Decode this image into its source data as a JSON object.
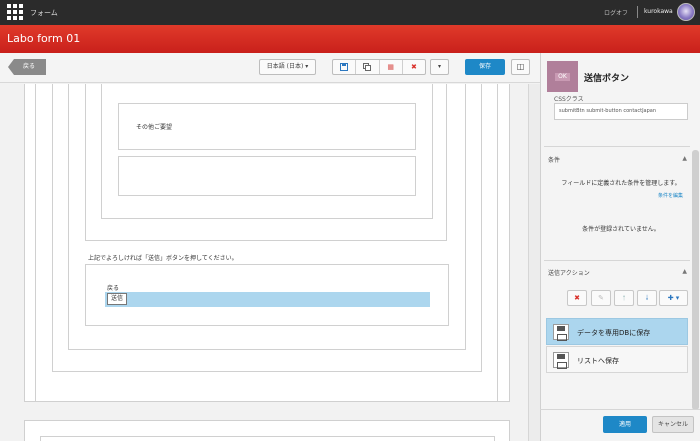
{
  "topbar": {
    "app_name": "フォーム",
    "logout": "ログオフ",
    "username": "kurokawa"
  },
  "header": {
    "form_title": "Labo form 01"
  },
  "toolbar": {
    "back_label": "戻る",
    "language": "日本語 (日本)",
    "save_label": "保存"
  },
  "canvas": {
    "other_label": "その他ご要望",
    "notice_text": "上記でよろしければ「送信」ボタンを押してください。",
    "back_text": "戻る",
    "submit_text": "送信"
  },
  "panel": {
    "thumb_text": "OK",
    "title": "送信ボタン",
    "css_label": "CSSクラス",
    "css_value": "submitBtn submit-button contactJapan",
    "conditions": {
      "heading": "条件",
      "description": "フィールドに定義された条件を管理します。",
      "edit_link": "条件を編集",
      "empty": "条件が登録されていません。"
    },
    "actions": {
      "heading": "送信アクション",
      "items": [
        "データを専用DBに保存",
        "リストへ保存"
      ]
    },
    "apply": "適用",
    "cancel": "キャンセル"
  },
  "colors": {
    "header_red": "#d42b21",
    "accent_blue": "#1e88c7",
    "selection_blue": "#acd6ee"
  }
}
